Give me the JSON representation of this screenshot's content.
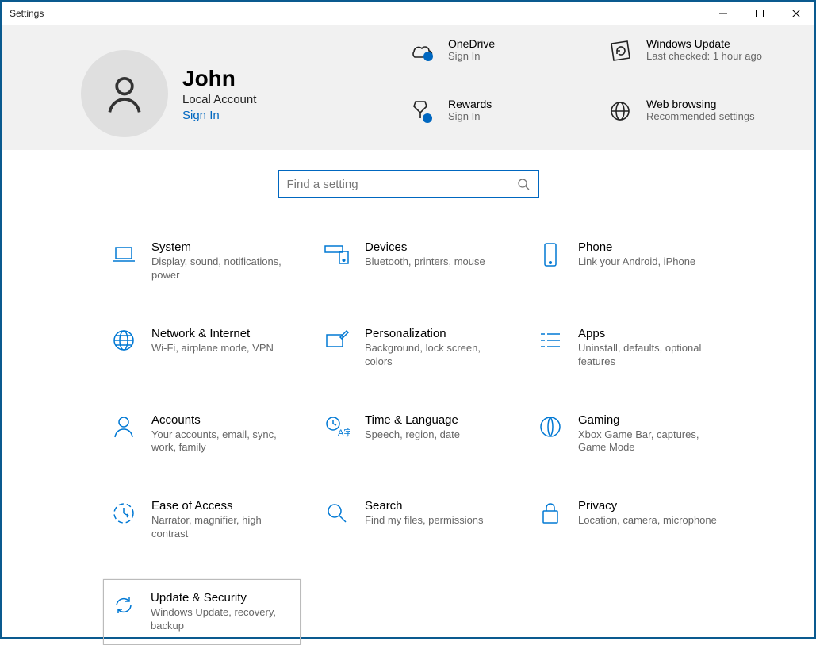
{
  "window": {
    "title": "Settings"
  },
  "account": {
    "name": "John",
    "type": "Local Account",
    "signin": "Sign In"
  },
  "tiles": {
    "onedrive": {
      "title": "OneDrive",
      "sub": "Sign In"
    },
    "update": {
      "title": "Windows Update",
      "sub": "Last checked: 1 hour ago"
    },
    "rewards": {
      "title": "Rewards",
      "sub": "Sign In"
    },
    "browsing": {
      "title": "Web browsing",
      "sub": "Recommended settings"
    }
  },
  "search": {
    "placeholder": "Find a setting"
  },
  "categories": [
    {
      "title": "System",
      "desc": "Display, sound, notifications, power",
      "icon": "laptop"
    },
    {
      "title": "Devices",
      "desc": "Bluetooth, printers, mouse",
      "icon": "devices"
    },
    {
      "title": "Phone",
      "desc": "Link your Android, iPhone",
      "icon": "phone"
    },
    {
      "title": "Network & Internet",
      "desc": "Wi-Fi, airplane mode, VPN",
      "icon": "globe"
    },
    {
      "title": "Personalization",
      "desc": "Background, lock screen, colors",
      "icon": "brush"
    },
    {
      "title": "Apps",
      "desc": "Uninstall, defaults, optional features",
      "icon": "apps"
    },
    {
      "title": "Accounts",
      "desc": "Your accounts, email, sync, work, family",
      "icon": "person"
    },
    {
      "title": "Time & Language",
      "desc": "Speech, region, date",
      "icon": "time"
    },
    {
      "title": "Gaming",
      "desc": "Xbox Game Bar, captures, Game Mode",
      "icon": "gaming"
    },
    {
      "title": "Ease of Access",
      "desc": "Narrator, magnifier, high contrast",
      "icon": "ease"
    },
    {
      "title": "Search",
      "desc": "Find my files, permissions",
      "icon": "search"
    },
    {
      "title": "Privacy",
      "desc": "Location, camera, microphone",
      "icon": "lock"
    },
    {
      "title": "Update & Security",
      "desc": "Windows Update, recovery, backup",
      "icon": "sync"
    }
  ]
}
